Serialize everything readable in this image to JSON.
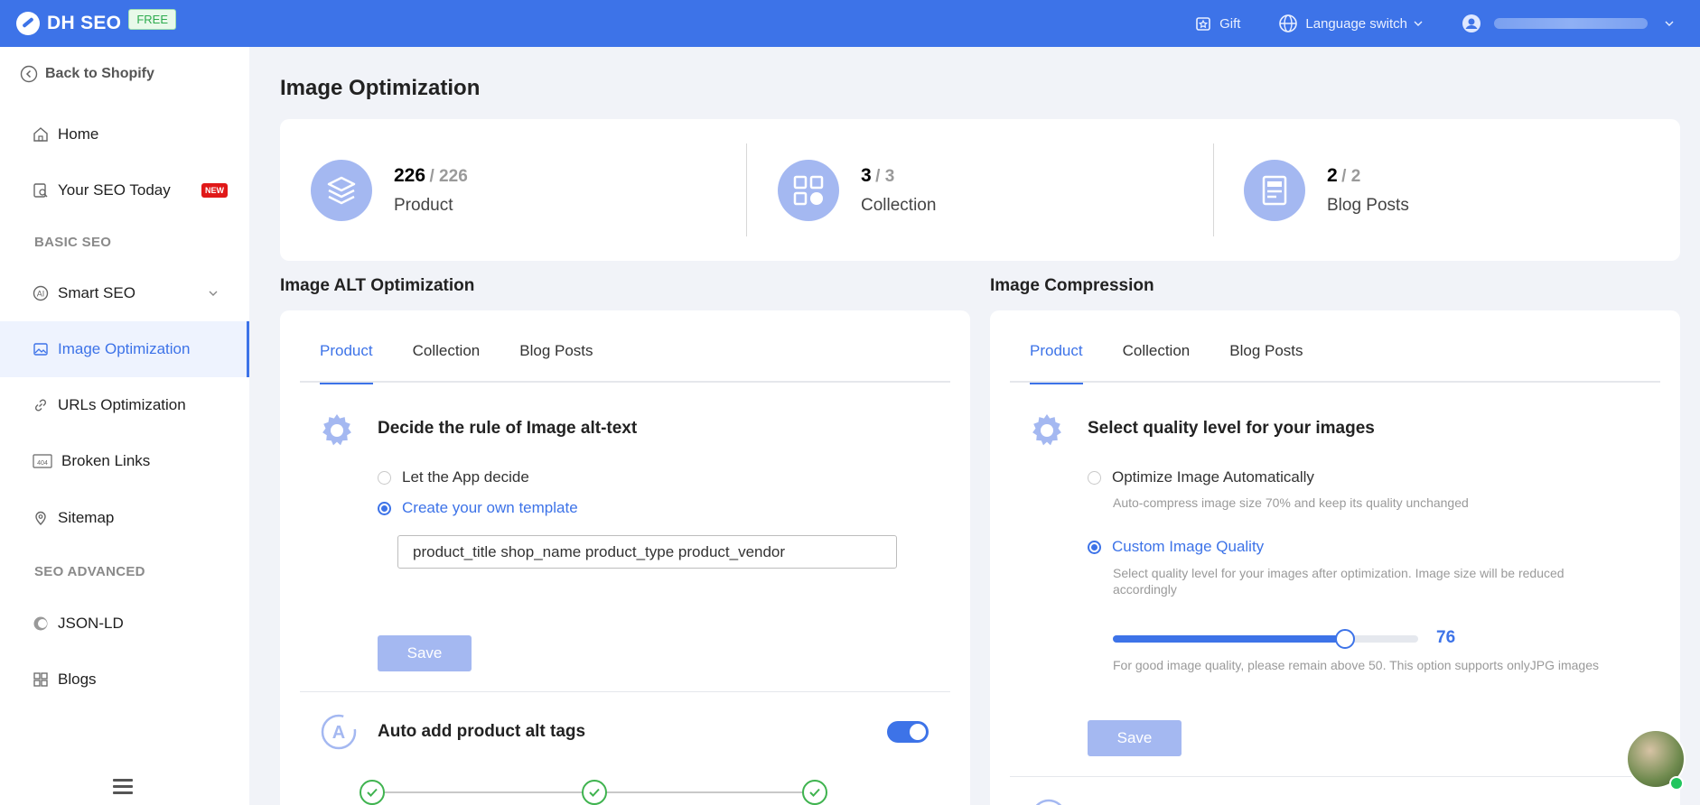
{
  "app": {
    "name": "DH SEO",
    "plan_badge": "FREE"
  },
  "topbar": {
    "gift_label": "Gift",
    "language_label": "Language switch"
  },
  "sidebar": {
    "back_label": "Back to Shopify",
    "items": [
      {
        "label": "Home"
      },
      {
        "label": "Your SEO Today",
        "badge": "NEW"
      },
      {
        "label": "Smart SEO"
      },
      {
        "label": "Image Optimization"
      },
      {
        "label": "URLs Optimization"
      },
      {
        "label": "Broken Links"
      },
      {
        "label": "Sitemap"
      },
      {
        "label": "JSON-LD"
      },
      {
        "label": "Blogs"
      }
    ],
    "sections": {
      "basic": "BASIC SEO",
      "advanced": "SEO ADVANCED"
    },
    "broken_links_icon_text": "404"
  },
  "page": {
    "title": "Image Optimization"
  },
  "stats": [
    {
      "count": "226",
      "total": "/ 226",
      "label": "Product"
    },
    {
      "count": "3",
      "total": "/ 3",
      "label": "Collection"
    },
    {
      "count": "2",
      "total": "/ 2",
      "label": "Blog Posts"
    }
  ],
  "alt": {
    "section_title": "Image ALT Optimization",
    "tabs": [
      "Product",
      "Collection",
      "Blog Posts"
    ],
    "rule_title": "Decide the rule of Image alt-text",
    "option_app": "Let the App decide",
    "option_template": "Create your own template",
    "template_value": "product_title shop_name product_type product_vendor",
    "save_label": "Save",
    "auto_title": "Auto add product alt tags",
    "auto_enabled": true
  },
  "compression": {
    "section_title": "Image Compression",
    "tabs": [
      "Product",
      "Collection",
      "Blog Posts"
    ],
    "quality_title": "Select quality level for your images",
    "option_auto": "Optimize Image Automatically",
    "option_auto_desc": "Auto-compress image size 70% and keep its quality unchanged",
    "option_custom": "Custom Image Quality",
    "option_custom_desc": "Select quality level for your images after optimization. Image size will be reduced accordingly",
    "quality_value": 76,
    "quality_display": "76",
    "quality_hint": "For good image quality, please remain above 50. This option supports onlyJPG images",
    "save_label": "Save"
  },
  "colors": {
    "brand": "#3d73e8",
    "disabled_button": "#a4b8f1",
    "success": "#3fb34f",
    "badge_new": "#e01818"
  }
}
